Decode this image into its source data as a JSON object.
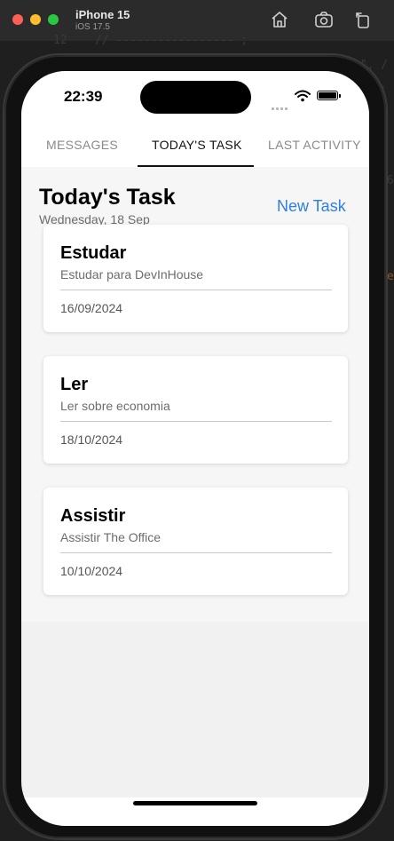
{
  "simulator": {
    "device_name": "iPhone 15",
    "os_version": "iOS 17.5"
  },
  "status_bar": {
    "time": "22:39"
  },
  "tabs": [
    {
      "label": "MESSAGES",
      "active": false
    },
    {
      "label": "TODAY'S TASK",
      "active": true
    },
    {
      "label": "LAST ACTIVITY",
      "active": false
    }
  ],
  "header": {
    "title": "Today's Task",
    "date": "Wednesday, 18 Sep",
    "new_task_label": "New Task"
  },
  "tasks": [
    {
      "title": "Estudar",
      "description": "Estudar para DevInHouse",
      "date": "16/09/2024"
    },
    {
      "title": "Ler",
      "description": "Ler sobre economia",
      "date": "18/10/2024"
    },
    {
      "title": "Assistir",
      "description": "Assistir The Office",
      "date": "10/10/2024"
    }
  ],
  "colors": {
    "accent": "#2f7fe0",
    "background": "#f1f1f1",
    "card": "#ffffff"
  }
}
